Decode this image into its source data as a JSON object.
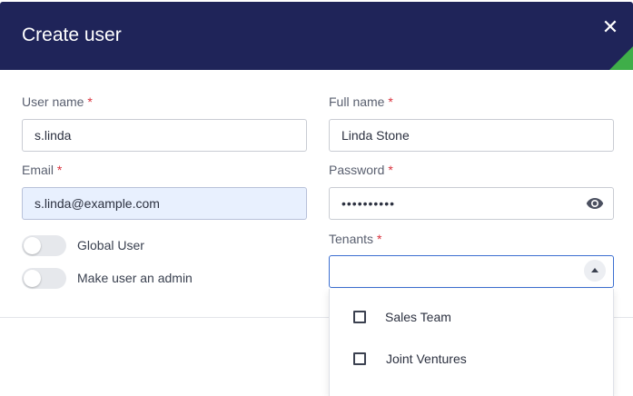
{
  "dialog": {
    "title": "Create user",
    "close_glyph": "✕"
  },
  "fields": {
    "username": {
      "label": "User name",
      "required_mark": "*",
      "value": "s.linda"
    },
    "fullname": {
      "label": "Full name",
      "required_mark": "*",
      "value": "Linda Stone"
    },
    "email": {
      "label": "Email",
      "required_mark": "*",
      "value": "s.linda@example.com"
    },
    "password": {
      "label": "Password",
      "required_mark": "*",
      "value_masked": "••••••••••",
      "toggle_icon": "eye-icon"
    },
    "tenants": {
      "label": "Tenants",
      "required_mark": "*",
      "value": ""
    }
  },
  "toggles": {
    "global_user": {
      "label": "Global User",
      "on": false
    },
    "make_admin": {
      "label": "Make user an admin",
      "on": false
    }
  },
  "tenant_options": [
    {
      "label": "Sales Team",
      "checked": false
    },
    {
      "label": "Joint Ventures",
      "checked": false
    }
  ],
  "colors": {
    "header_bg": "#1f2459",
    "accent_green": "#3fae49",
    "required_red": "#d9313c",
    "focus_blue": "#3c6fd1",
    "autofill_bg": "#e8f0fe"
  }
}
